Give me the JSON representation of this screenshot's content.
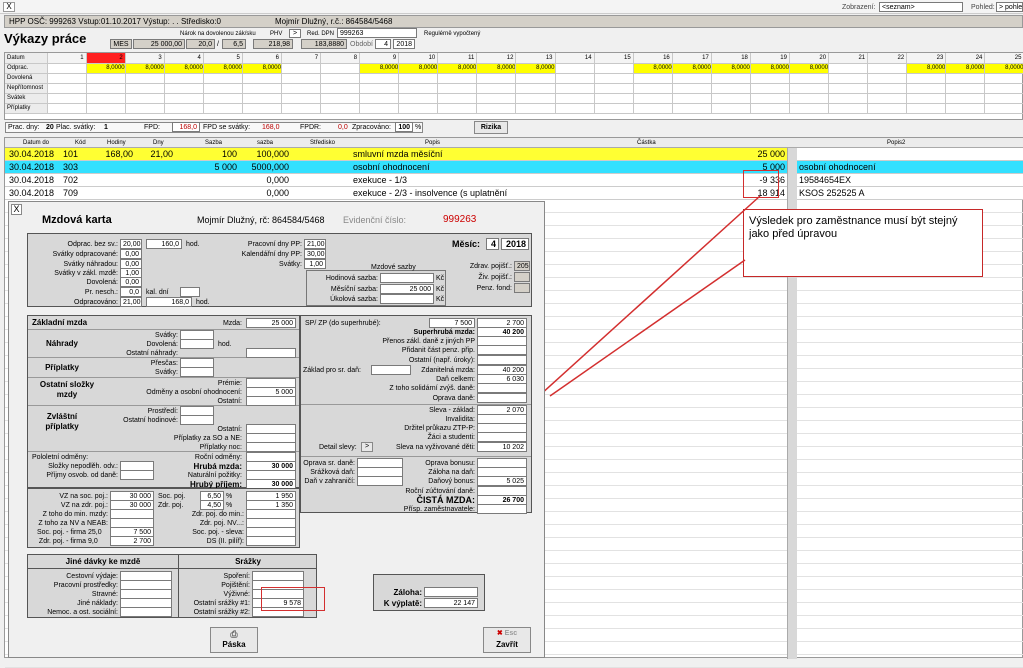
{
  "window": {
    "close": "X"
  },
  "topright": {
    "zobrazeni_label": "Zobrazení:",
    "zobrazeni_value": "<seznam>",
    "pohled_label": "Pohled:",
    "pohled_value": "> pohled"
  },
  "header": {
    "text": "HPP  OSČ: 999263  Vstup:01.10.2017 Výstup: .  .    Středisko:0",
    "name": "Mojmír Dlužný, r.č.: 864584/5468"
  },
  "title": "Výkazy práce",
  "params": {
    "narok_label": "Nárok na dovolenou zák/sku",
    "phv_label": "PHV",
    "red_dpn_label": "Red. DPN",
    "red_dpn_value": "999263",
    "regul": "Regulérně vypočtený",
    "mes_label": "MES",
    "mes_value": "25 000,00",
    "v1": "20,0",
    "v2": "6,5",
    "v3": "218,98",
    "v4": "183,8880",
    "obdobi_label": "Období",
    "obdobi_m": "4",
    "obdobi_y": "2018"
  },
  "grid": {
    "row_labels": [
      "Datum",
      "Odprac.",
      "Dovolená",
      "Nepřítomnost",
      "Svátek",
      "Příplatky"
    ],
    "days": [
      "1",
      "2",
      "3",
      "4",
      "5",
      "6",
      "7",
      "8",
      "9",
      "10",
      "11",
      "12",
      "13",
      "14",
      "15",
      "16",
      "17",
      "18",
      "19",
      "20",
      "21",
      "22",
      "23",
      "24",
      "25"
    ],
    "odprac": [
      "",
      "8,0000",
      "8,0000",
      "8,0000",
      "8,0000",
      "8,0000",
      "",
      "",
      "8,0000",
      "8,0000",
      "8,0000",
      "8,0000",
      "8,0000",
      "",
      "",
      "8,0000",
      "8,0000",
      "8,0000",
      "8,0000",
      "8,0000",
      "",
      "",
      "8,0000",
      "8,0000",
      "8,0000"
    ]
  },
  "summary": {
    "prac_dny_label": "Prac. dny:",
    "prac_dny": "20",
    "plac_svatky_label": "Plac. svátky:",
    "plac_svatky": "1",
    "fpd_label": "FPD:",
    "fpd": "168,0",
    "fpd_svatky_label": "FPD se svátky:",
    "fpd_svatky": "168,0",
    "fpdr_label": "FPDR:",
    "fpdr": "0,0",
    "zprac_label": "Zpracováno:",
    "zprac": "100",
    "pct": "%",
    "rizika": "Rizika"
  },
  "list": {
    "headers": [
      "Datum do",
      "Kód",
      "Hodiny",
      "Dny",
      "Sazba",
      "sazba",
      "Středisko",
      "Popis",
      "Částka",
      "Popis2"
    ],
    "rows": [
      {
        "date": "30.04.2018",
        "kod": "101",
        "hod": "168,00",
        "dny": "21,00",
        "sazba": "100",
        "sazba2": "100,000",
        "popis": "smluvní mzda měsíční",
        "castka": "25 000",
        "btn": "",
        "popis2": ""
      },
      {
        "date": "30.04.2018",
        "kod": "303",
        "hod": "",
        "dny": "",
        "sazba": "5 000",
        "sazba2": "5000,000",
        "popis": "osobní ohodnocení",
        "castka": "5 000",
        "btn": ">",
        "popis2": "osobní ohodnocení"
      },
      {
        "date": "30.04.2018",
        "kod": "702",
        "hod": "",
        "dny": "",
        "sazba": "",
        "sazba2": "0,000",
        "popis": "exekuce - 1/3",
        "castka": "-9 336",
        "btn": ">",
        "popis2": "19584654EX"
      },
      {
        "date": "30.04.2018",
        "kod": "709",
        "hod": "",
        "dny": "",
        "sazba": "",
        "sazba2": "0,000",
        "popis": "exekuce - 2/3 - insolvence (s uplatnění",
        "castka": "18 914",
        "btn": ">",
        "popis2": "KSOS 252525 A"
      }
    ]
  },
  "callout": "Výsledek pro zaměstnance musí být stejný jako před úpravou",
  "mk": {
    "close": "X",
    "title": "Mzdová karta",
    "name": "Mojmír Dlužný, rč: 864584/5468",
    "evid_label": "Evidenční číslo:",
    "evid": "999263",
    "top": {
      "odprac_label": "Odprac. bez sv.:",
      "odprac_d": "20,00",
      "odprac_h": "160,0",
      "hod": "hod.",
      "svatky_odpr_label": "Svátky odpracované:",
      "svatky_odpr": "0,00",
      "svatky_nahr_label": "Svátky náhradou:",
      "svatky_nahr": "0,00",
      "svatky_zakl_label": "Svátky v zákl. mzdě:",
      "svatky_zakl": "1,00",
      "dovolena_label": "Dovolená:",
      "dovolena": "0,00",
      "pr_nesch_label": "Pr. nesch.:",
      "pr_nesch": "0,0",
      "kal_dni": "kal. dní",
      "odpracovano_label": "Odpracováno:",
      "odpracovano_d": "21,00",
      "odpracovano_h": "168,0",
      "hod2": "hod.",
      "pracovni_pp_label": "Pracovní dny PP:",
      "pracovni_pp": "21,00",
      "kal_pp_label": "Kalendářní dny PP:",
      "kal_pp": "30,00",
      "svatky_label": "Svátky:",
      "svatky": "1,00",
      "mesic_label": "Měsíc:",
      "mesic": "4",
      "rok": "2018",
      "mzdove_sazby": "Mzdové sazby",
      "hod_sazba_label": "Hodinová sazba:",
      "mes_sazba_label": "Měsíční sazba:",
      "mes_sazba": "25 000",
      "uk_sazba_label": "Úkolová sazba:",
      "kc": "Kč",
      "zdrav_label": "Zdrav. pojišť.:",
      "zdrav": "205",
      "ziv_label": "Živ. pojišť.:",
      "penz_label": "Penz. fond:"
    },
    "left": {
      "zakl_mzda": "Základní mzda",
      "mzda_label": "Mzda:",
      "mzda": "25 000",
      "nahrady": "Náhrady",
      "svatky": "Svátky:",
      "dovolena": "Dovolená:",
      "ost_nahr": "Ostatní náhrady:",
      "hod": "hod.",
      "priplatky": "Příplatky",
      "prescas": "Přesčas:",
      "svatky2": "Svátky:",
      "ost_slozky": "Ostatní složky mzdy",
      "premie": "Prémie:",
      "odmeny": "Odměny a osobní ohodnocení:",
      "odmeny_val": "5 000",
      "ostatni": "Ostatní:",
      "zvl_pripl": "Zvláštní příplatky",
      "prostredi": "Prostředí:",
      "ost_hod": "Ostatní hodinové:",
      "ostatni2": "Ostatní:",
      "pripl_so": "Příplatky za SO a NE:",
      "pripl_noc": "Příplatky noc:",
      "pololetni": "Pololetní odměny:",
      "rocni": "Roční odměny:",
      "slozky_nepodl": "Složky nepodlěh. odv.:",
      "prijmy_osvob": "Příjmy osvob. od daně:",
      "hruba_mzda_label": "Hrubá mzda:",
      "hruba_mzda": "30 000",
      "natur": "Naturální požitky:",
      "hruby_prijem_label": "Hrubý příjem:",
      "hruby_prijem": "30 000"
    },
    "poj": {
      "vz_soc_label": "VZ na soc. poj.:",
      "vz_soc": "30 000",
      "soc_poj_label": "Soc. poj.",
      "soc_pct": "6,50",
      "soc_val": "1 950",
      "vz_zdr_label": "VZ na zdr. poj.:",
      "vz_zdr": "30 000",
      "zdr_poj_label": "Zdr. poj.",
      "zdr_pct": "4,50",
      "zdr_val": "1 350",
      "z_min_label": "Z toho do min. mzdy:",
      "zdr_min_label": "Zdr. poj. do min.:",
      "z_nv_label": "Z toho za NV a NEAB:",
      "zdr_nv_label": "Zdr. poj. NV...:",
      "soc_firma_label": "Soc. poj. - firma",
      "soc_firma_pct": "25,0",
      "soc_firma": "7 500",
      "soc_sleva_label": "Soc. poj. - sleva:",
      "zdr_firma_label": "Zdr. poj. - firma",
      "zdr_firma_pct": "9,0",
      "zdr_firma": "2 700",
      "ds_label": "DS (II. pilíř):",
      "pct": "%"
    },
    "right": {
      "spzp_label": "SP/ ZP (do superhrubé):",
      "sp": "7 500",
      "zp": "2 700",
      "superhruba_label": "Superhrubá mzda:",
      "superhruba": "40 200",
      "prenos_label": "Přenos zákl. daně z jiných PP",
      "pridanit_label": "Přidanit část penz. přip.",
      "ostatni_label": "Ostatní (např. úroky):",
      "zaklad_label": "Základ pro sr. daň:",
      "zdanitelna_label": "Zdanitelná mzda:",
      "zdanitelna": "40 200",
      "dan_label": "Daň celkem:",
      "dan": "6 030",
      "solid_label": "Z toho solidární zvýš. daně:",
      "oprava_dane_label": "Oprava daně:",
      "sleva_zakl_label": "Sleva - základ:",
      "sleva_zakl": "2 070",
      "invalidita_label": "Invalidita:",
      "ztp_label": "Držitel průkazu ZTP-P:",
      "zaci_label": "Žáci a studenti:",
      "detail_slevy": "Detail slevy:",
      "detail_btn": ">",
      "sleva_vyziv_label": "Sleva na vyživované děti:",
      "sleva_vyziv": "10 202",
      "oprava_sr_label": "Oprava sr. daně:",
      "srazkova_label": "Srážková daň:",
      "dan_zahr_label": "Daň v zahraničí:",
      "oprava_bonusu_label": "Oprava bonusu:",
      "zaloha_dan_label": "Záloha na daň:",
      "danovy_bonus_label": "Daňový bonus:",
      "danovy_bonus": "5 025",
      "rocni_zuct_label": "Roční zúčtování daně:",
      "cista_label": "ČISTÁ MZDA:",
      "cista": "26 700",
      "prisp_label": "Přísp. zaměstnavatele:"
    },
    "jine": {
      "title": "Jiné dávky ke mzdě",
      "cestovni": "Cestovní výdaje:",
      "pracovni": "Pracovní prostředky:",
      "stravne": "Stravné:",
      "jine_nakl": "Jiné náklady:",
      "nemoc": "Nemoc. a ost. sociální:"
    },
    "srazky": {
      "title": "Srážky",
      "sporeni": "Spoření:",
      "pojisteni": "Pojištění:",
      "vyzivne": "Výživné:",
      "ost1_label": "Ostatní srážky #1:",
      "ost1": "9 578",
      "ost2_label": "Ostatní srážky #2:"
    },
    "vyplata": {
      "zaloha_label": "Záloha:",
      "kvyplate_label": "K výplatě:",
      "kvyplate": "22 147"
    },
    "buttons": {
      "paska": "Páska",
      "esc": "Esc",
      "zavrit": "Zavřít"
    }
  }
}
